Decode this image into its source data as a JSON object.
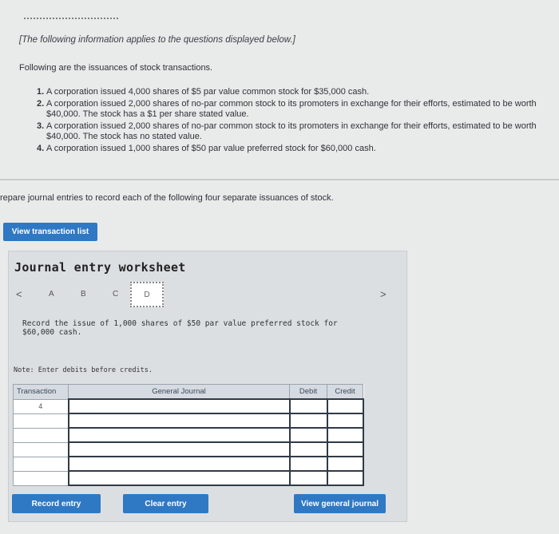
{
  "header": {
    "intro_note": "[The following information applies to the questions displayed below.]",
    "lead": "Following are the issuances of stock transactions.",
    "items": [
      {
        "num": "1.",
        "text": "A corporation issued 4,000 shares of $5 par value common stock for $35,000 cash."
      },
      {
        "num": "2.",
        "text": "A corporation issued 2,000 shares of no-par common stock to its promoters in exchange for their efforts, estimated to be worth $40,000. The stock has a $1 per share stated value."
      },
      {
        "num": "3.",
        "text": "A corporation issued 2,000 shares of no-par common stock to its promoters in exchange for their efforts, estimated to be worth $40,000. The stock has no stated value."
      },
      {
        "num": "4.",
        "text": "A corporation issued 1,000 shares of $50 par value preferred stock for $60,000 cash."
      }
    ]
  },
  "prompt": "repare journal entries to record each of the following four separate issuances of stock.",
  "buttons": {
    "view_transaction_list": "View transaction list",
    "record_entry": "Record entry",
    "clear_entry": "Clear entry",
    "view_general_journal": "View general journal"
  },
  "worksheet": {
    "title": "Journal entry worksheet",
    "prev": "<",
    "next": ">",
    "tabs": [
      "A",
      "B",
      "C",
      "D"
    ],
    "instruction": "Record the issue of 1,000 shares of $50 par value preferred stock for $60,000 cash.",
    "note": "Note: Enter debits before credits."
  },
  "journal": {
    "headers": {
      "transaction": "Transaction",
      "general_journal": "General Journal",
      "debit": "Debit",
      "credit": "Credit"
    },
    "rows": [
      {
        "transaction": "4"
      },
      {
        "transaction": ""
      },
      {
        "transaction": ""
      },
      {
        "transaction": ""
      },
      {
        "transaction": ""
      },
      {
        "transaction": ""
      }
    ]
  }
}
